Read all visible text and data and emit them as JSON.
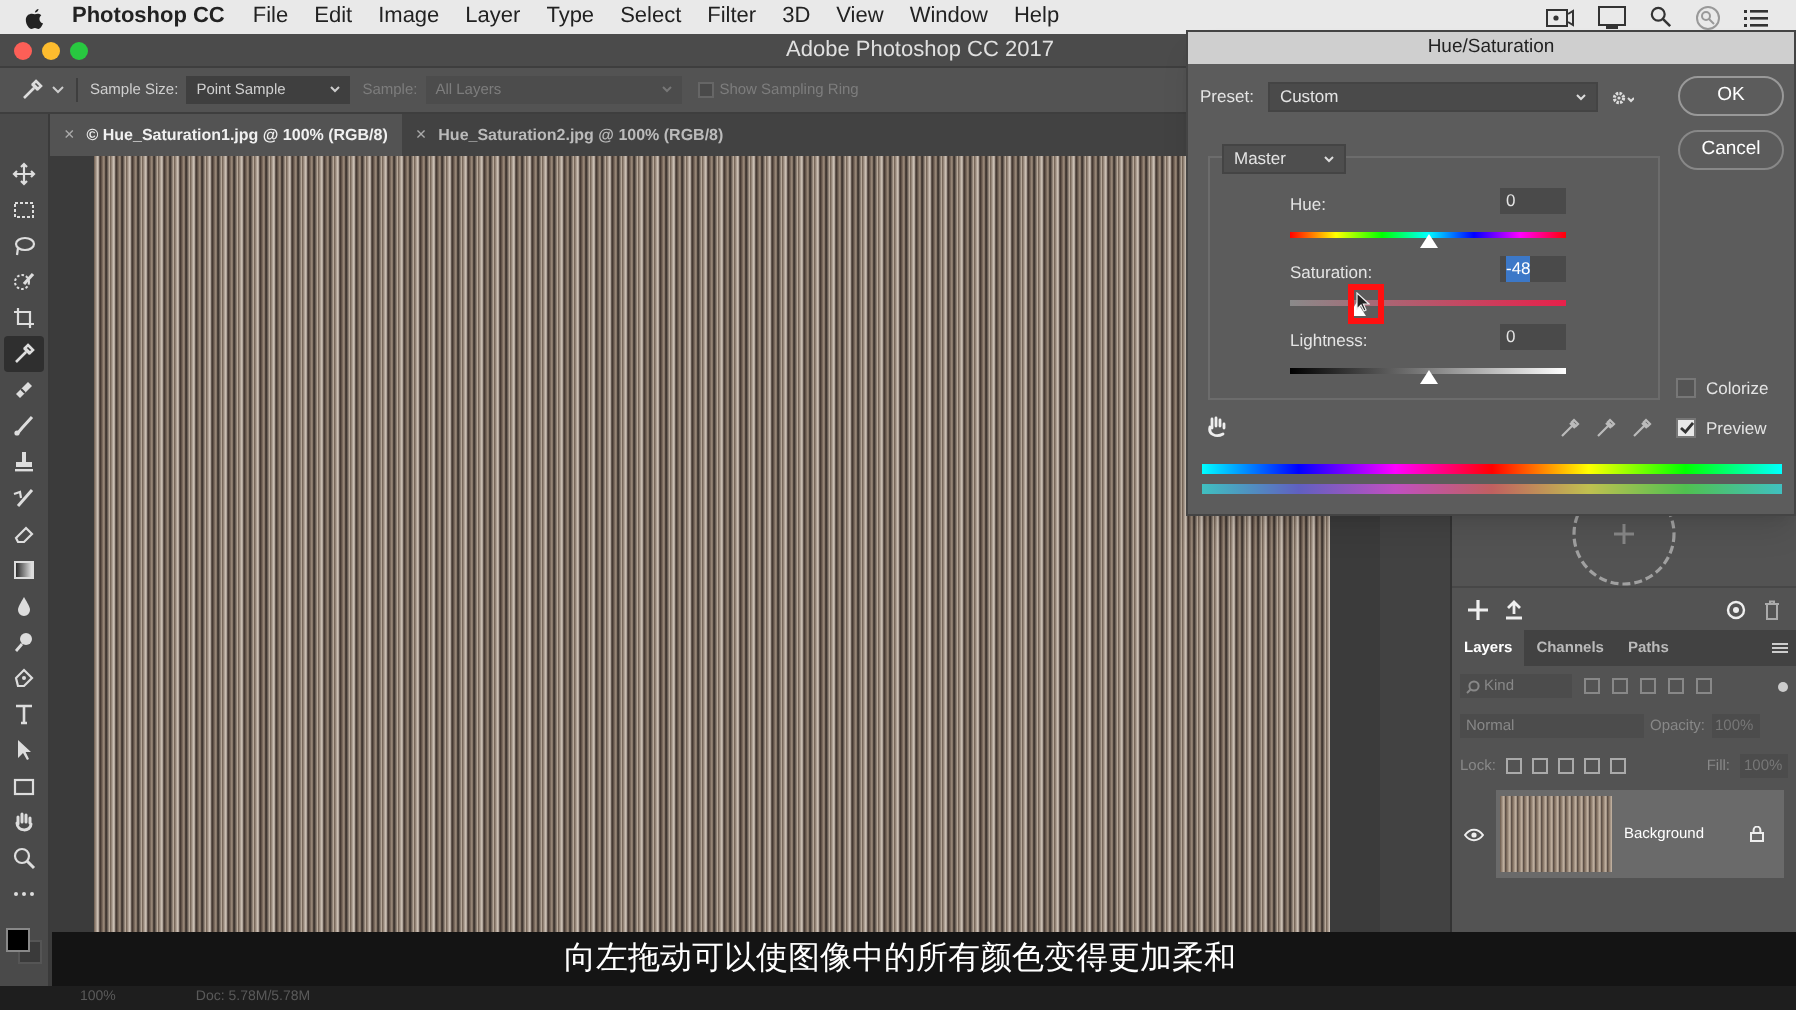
{
  "menu_bar": {
    "app": "Photoshop CC",
    "items": [
      "File",
      "Edit",
      "Image",
      "Layer",
      "Type",
      "Select",
      "Filter",
      "3D",
      "View",
      "Window",
      "Help"
    ]
  },
  "window": {
    "title": "Adobe Photoshop CC 2017"
  },
  "options_bar": {
    "sample_size_label": "Sample Size:",
    "sample_size": "Point Sample",
    "sample_label": "Sample:",
    "sample": "All Layers",
    "sample_disabled": true,
    "show_sampling_ring": {
      "label": "Show Sampling Ring",
      "checked": false,
      "disabled": true
    }
  },
  "document_tabs": [
    {
      "close": "×",
      "label": "© Hue_Saturation1.jpg @ 100% (RGB/8)",
      "selected": true
    },
    {
      "close": "×",
      "label": "Hue_Saturation2.jpg @ 100% (RGB/8)",
      "selected": false
    }
  ],
  "tools": [
    {
      "kind": "move",
      "selected": false
    },
    {
      "kind": "marquee",
      "selected": false
    },
    {
      "kind": "lasso",
      "selected": false
    },
    {
      "kind": "quickselect",
      "selected": false
    },
    {
      "kind": "crop",
      "selected": false
    },
    {
      "kind": "eyedropper",
      "selected": true
    },
    {
      "kind": "bandage",
      "selected": false
    },
    {
      "kind": "brush",
      "selected": false
    },
    {
      "kind": "stamp",
      "selected": false
    },
    {
      "kind": "historybrush",
      "selected": false
    },
    {
      "kind": "eraser",
      "selected": false
    },
    {
      "kind": "gradient",
      "selected": false
    },
    {
      "kind": "drop",
      "selected": false
    },
    {
      "kind": "dodge",
      "selected": false
    },
    {
      "kind": "pen",
      "selected": false
    },
    {
      "kind": "type",
      "selected": false
    },
    {
      "kind": "pointer",
      "selected": false
    },
    {
      "kind": "rectangle",
      "selected": false
    },
    {
      "kind": "hand",
      "selected": false
    },
    {
      "kind": "zoom",
      "selected": false
    },
    {
      "kind": "more",
      "selected": false
    }
  ],
  "dialog": {
    "title": "Hue/Saturation",
    "preset_label": "Preset:",
    "preset": "Custom",
    "ok": "OK",
    "cancel": "Cancel",
    "channel": "Master",
    "sliders": [
      {
        "kind": "hue",
        "label": "Hue:",
        "value": "0",
        "level": 0.5,
        "selected": false
      },
      {
        "kind": "saturation",
        "label": "Saturation:",
        "value": "-48",
        "level": 0.24,
        "selected": true
      },
      {
        "kind": "lightness",
        "label": "Lightness:",
        "value": "0",
        "level": 0.5,
        "selected": false
      }
    ],
    "colorize": {
      "label": "Colorize",
      "checked": false
    },
    "preview": {
      "label": "Preview",
      "checked": true
    }
  },
  "layers_panel": {
    "tabs": [
      {
        "label": "Layers",
        "selected": true
      },
      {
        "label": "Channels",
        "selected": false
      },
      {
        "label": "Paths",
        "selected": false
      }
    ],
    "kind_filter": "Kind",
    "blend_mode": "Normal",
    "opacity_label": "Opacity:",
    "opacity": "100%",
    "lock_label": "Lock:",
    "fill_label": "Fill:",
    "fill": "100%",
    "layers": [
      {
        "name": "Background",
        "visible": true,
        "locked": true
      }
    ]
  },
  "status_bar": {
    "zoom": "100%",
    "doc": "Doc: 5.78M/5.78M"
  },
  "subtitle": "向左拖动可以使图像中的所有颜色变得更加柔和"
}
